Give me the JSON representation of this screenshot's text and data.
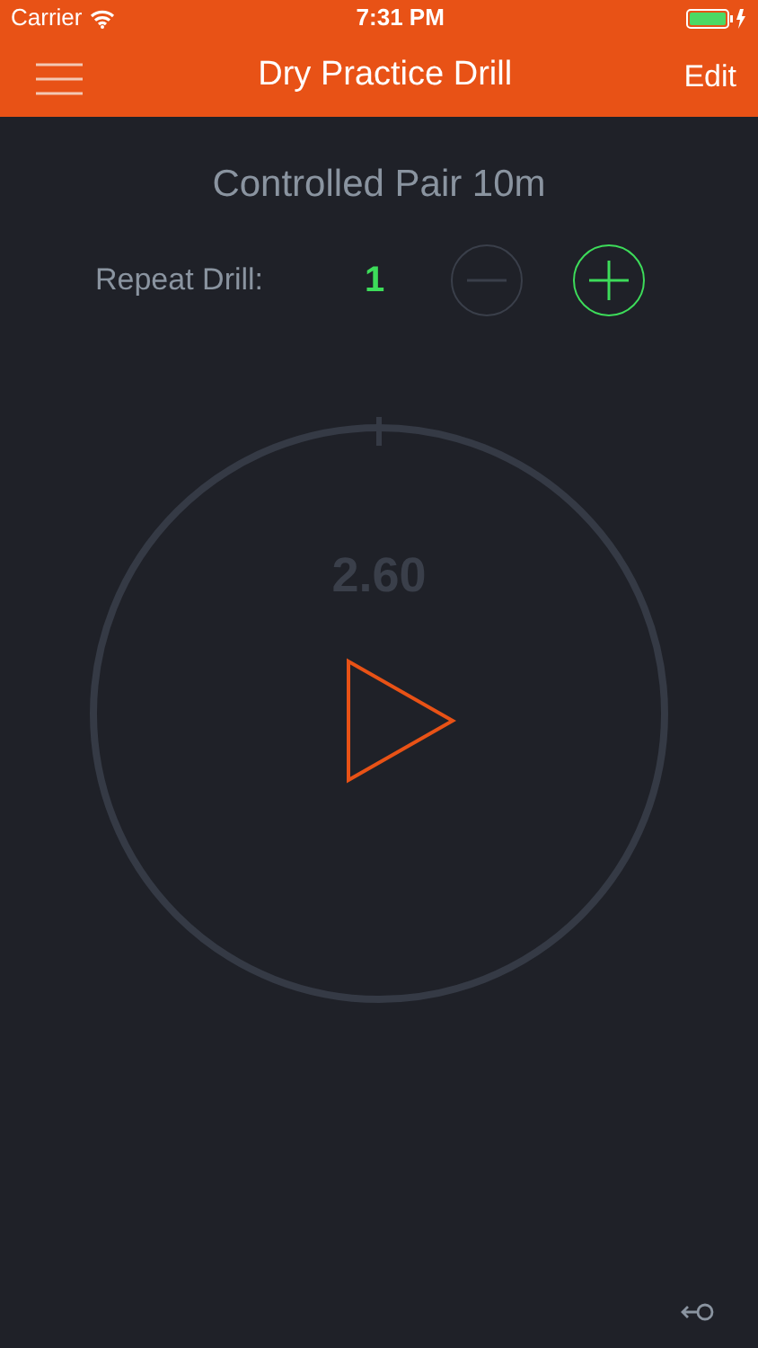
{
  "status_bar": {
    "carrier": "Carrier",
    "time": "7:31 PM"
  },
  "nav": {
    "title": "Dry Practice Drill",
    "edit": "Edit"
  },
  "drill_name": "Controlled Pair 10m",
  "repeat": {
    "label": "Repeat Drill:",
    "count": "1",
    "decrease_disabled": true,
    "increase_disabled": false
  },
  "timer": {
    "reading": "2.60"
  }
}
